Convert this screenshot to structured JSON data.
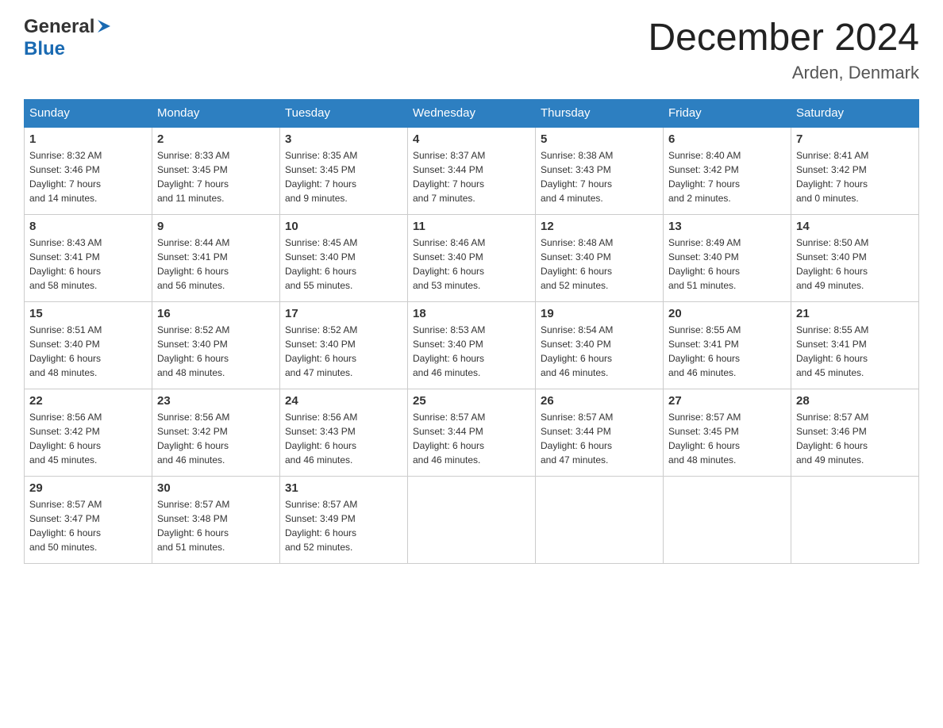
{
  "header": {
    "logo_general": "General",
    "logo_blue": "Blue",
    "title": "December 2024",
    "subtitle": "Arden, Denmark"
  },
  "calendar": {
    "weekdays": [
      "Sunday",
      "Monday",
      "Tuesday",
      "Wednesday",
      "Thursday",
      "Friday",
      "Saturday"
    ],
    "weeks": [
      [
        {
          "day": "1",
          "sunrise": "Sunrise: 8:32 AM",
          "sunset": "Sunset: 3:46 PM",
          "daylight": "Daylight: 7 hours",
          "daylight2": "and 14 minutes."
        },
        {
          "day": "2",
          "sunrise": "Sunrise: 8:33 AM",
          "sunset": "Sunset: 3:45 PM",
          "daylight": "Daylight: 7 hours",
          "daylight2": "and 11 minutes."
        },
        {
          "day": "3",
          "sunrise": "Sunrise: 8:35 AM",
          "sunset": "Sunset: 3:45 PM",
          "daylight": "Daylight: 7 hours",
          "daylight2": "and 9 minutes."
        },
        {
          "day": "4",
          "sunrise": "Sunrise: 8:37 AM",
          "sunset": "Sunset: 3:44 PM",
          "daylight": "Daylight: 7 hours",
          "daylight2": "and 7 minutes."
        },
        {
          "day": "5",
          "sunrise": "Sunrise: 8:38 AM",
          "sunset": "Sunset: 3:43 PM",
          "daylight": "Daylight: 7 hours",
          "daylight2": "and 4 minutes."
        },
        {
          "day": "6",
          "sunrise": "Sunrise: 8:40 AM",
          "sunset": "Sunset: 3:42 PM",
          "daylight": "Daylight: 7 hours",
          "daylight2": "and 2 minutes."
        },
        {
          "day": "7",
          "sunrise": "Sunrise: 8:41 AM",
          "sunset": "Sunset: 3:42 PM",
          "daylight": "Daylight: 7 hours",
          "daylight2": "and 0 minutes."
        }
      ],
      [
        {
          "day": "8",
          "sunrise": "Sunrise: 8:43 AM",
          "sunset": "Sunset: 3:41 PM",
          "daylight": "Daylight: 6 hours",
          "daylight2": "and 58 minutes."
        },
        {
          "day": "9",
          "sunrise": "Sunrise: 8:44 AM",
          "sunset": "Sunset: 3:41 PM",
          "daylight": "Daylight: 6 hours",
          "daylight2": "and 56 minutes."
        },
        {
          "day": "10",
          "sunrise": "Sunrise: 8:45 AM",
          "sunset": "Sunset: 3:40 PM",
          "daylight": "Daylight: 6 hours",
          "daylight2": "and 55 minutes."
        },
        {
          "day": "11",
          "sunrise": "Sunrise: 8:46 AM",
          "sunset": "Sunset: 3:40 PM",
          "daylight": "Daylight: 6 hours",
          "daylight2": "and 53 minutes."
        },
        {
          "day": "12",
          "sunrise": "Sunrise: 8:48 AM",
          "sunset": "Sunset: 3:40 PM",
          "daylight": "Daylight: 6 hours",
          "daylight2": "and 52 minutes."
        },
        {
          "day": "13",
          "sunrise": "Sunrise: 8:49 AM",
          "sunset": "Sunset: 3:40 PM",
          "daylight": "Daylight: 6 hours",
          "daylight2": "and 51 minutes."
        },
        {
          "day": "14",
          "sunrise": "Sunrise: 8:50 AM",
          "sunset": "Sunset: 3:40 PM",
          "daylight": "Daylight: 6 hours",
          "daylight2": "and 49 minutes."
        }
      ],
      [
        {
          "day": "15",
          "sunrise": "Sunrise: 8:51 AM",
          "sunset": "Sunset: 3:40 PM",
          "daylight": "Daylight: 6 hours",
          "daylight2": "and 48 minutes."
        },
        {
          "day": "16",
          "sunrise": "Sunrise: 8:52 AM",
          "sunset": "Sunset: 3:40 PM",
          "daylight": "Daylight: 6 hours",
          "daylight2": "and 48 minutes."
        },
        {
          "day": "17",
          "sunrise": "Sunrise: 8:52 AM",
          "sunset": "Sunset: 3:40 PM",
          "daylight": "Daylight: 6 hours",
          "daylight2": "and 47 minutes."
        },
        {
          "day": "18",
          "sunrise": "Sunrise: 8:53 AM",
          "sunset": "Sunset: 3:40 PM",
          "daylight": "Daylight: 6 hours",
          "daylight2": "and 46 minutes."
        },
        {
          "day": "19",
          "sunrise": "Sunrise: 8:54 AM",
          "sunset": "Sunset: 3:40 PM",
          "daylight": "Daylight: 6 hours",
          "daylight2": "and 46 minutes."
        },
        {
          "day": "20",
          "sunrise": "Sunrise: 8:55 AM",
          "sunset": "Sunset: 3:41 PM",
          "daylight": "Daylight: 6 hours",
          "daylight2": "and 46 minutes."
        },
        {
          "day": "21",
          "sunrise": "Sunrise: 8:55 AM",
          "sunset": "Sunset: 3:41 PM",
          "daylight": "Daylight: 6 hours",
          "daylight2": "and 45 minutes."
        }
      ],
      [
        {
          "day": "22",
          "sunrise": "Sunrise: 8:56 AM",
          "sunset": "Sunset: 3:42 PM",
          "daylight": "Daylight: 6 hours",
          "daylight2": "and 45 minutes."
        },
        {
          "day": "23",
          "sunrise": "Sunrise: 8:56 AM",
          "sunset": "Sunset: 3:42 PM",
          "daylight": "Daylight: 6 hours",
          "daylight2": "and 46 minutes."
        },
        {
          "day": "24",
          "sunrise": "Sunrise: 8:56 AM",
          "sunset": "Sunset: 3:43 PM",
          "daylight": "Daylight: 6 hours",
          "daylight2": "and 46 minutes."
        },
        {
          "day": "25",
          "sunrise": "Sunrise: 8:57 AM",
          "sunset": "Sunset: 3:44 PM",
          "daylight": "Daylight: 6 hours",
          "daylight2": "and 46 minutes."
        },
        {
          "day": "26",
          "sunrise": "Sunrise: 8:57 AM",
          "sunset": "Sunset: 3:44 PM",
          "daylight": "Daylight: 6 hours",
          "daylight2": "and 47 minutes."
        },
        {
          "day": "27",
          "sunrise": "Sunrise: 8:57 AM",
          "sunset": "Sunset: 3:45 PM",
          "daylight": "Daylight: 6 hours",
          "daylight2": "and 48 minutes."
        },
        {
          "day": "28",
          "sunrise": "Sunrise: 8:57 AM",
          "sunset": "Sunset: 3:46 PM",
          "daylight": "Daylight: 6 hours",
          "daylight2": "and 49 minutes."
        }
      ],
      [
        {
          "day": "29",
          "sunrise": "Sunrise: 8:57 AM",
          "sunset": "Sunset: 3:47 PM",
          "daylight": "Daylight: 6 hours",
          "daylight2": "and 50 minutes."
        },
        {
          "day": "30",
          "sunrise": "Sunrise: 8:57 AM",
          "sunset": "Sunset: 3:48 PM",
          "daylight": "Daylight: 6 hours",
          "daylight2": "and 51 minutes."
        },
        {
          "day": "31",
          "sunrise": "Sunrise: 8:57 AM",
          "sunset": "Sunset: 3:49 PM",
          "daylight": "Daylight: 6 hours",
          "daylight2": "and 52 minutes."
        },
        {
          "day": "",
          "sunrise": "",
          "sunset": "",
          "daylight": "",
          "daylight2": ""
        },
        {
          "day": "",
          "sunrise": "",
          "sunset": "",
          "daylight": "",
          "daylight2": ""
        },
        {
          "day": "",
          "sunrise": "",
          "sunset": "",
          "daylight": "",
          "daylight2": ""
        },
        {
          "day": "",
          "sunrise": "",
          "sunset": "",
          "daylight": "",
          "daylight2": ""
        }
      ]
    ]
  }
}
